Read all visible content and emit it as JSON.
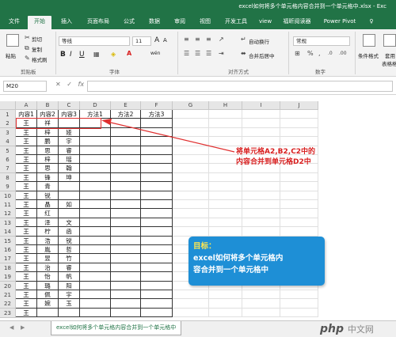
{
  "window": {
    "title": "excel如何将多个单元格内容合并到一个单元格中.xlsx - Exc"
  },
  "ribbon_tabs": [
    "文件",
    "开始",
    "插入",
    "页面布局",
    "公式",
    "数据",
    "审阅",
    "视图",
    "开发工具",
    "view",
    "福昕阅读器",
    "Power Pivot",
    "♀"
  ],
  "ribbon": {
    "clipboard": {
      "paste": "粘贴",
      "cut": "剪切",
      "copy": "复制",
      "format_painter": "格式刷",
      "label": "剪贴板"
    },
    "font": {
      "name": "等线",
      "size": "11",
      "bold": "B",
      "italic": "I",
      "underline": "U",
      "grow": "A",
      "shrink": "A",
      "wen": "wén",
      "label": "字体"
    },
    "alignment": {
      "wrap": "自动换行",
      "merge": "合并后居中",
      "label": "对齐方式"
    },
    "number": {
      "format": "常规",
      "label": "数字"
    },
    "styles": {
      "conditional": "条件格式",
      "table": "套用",
      "table2": "表格格"
    }
  },
  "formula_bar": {
    "name_box": "M20",
    "fx": "fx"
  },
  "columns": [
    "A",
    "B",
    "C",
    "D",
    "E",
    "F",
    "G",
    "H",
    "I",
    "J"
  ],
  "rows": [
    [
      "内容1",
      "内容2",
      "内容3",
      "方法1",
      "方法2",
      "方法3"
    ],
    [
      "王",
      "祥",
      "",
      "",
      "",
      ""
    ],
    [
      "王",
      "梓",
      "娅",
      "",
      "",
      ""
    ],
    [
      "王",
      "鹏",
      "宇",
      "",
      "",
      ""
    ],
    [
      "王",
      "思",
      "睿",
      "",
      "",
      ""
    ],
    [
      "王",
      "梓",
      "瑶",
      "",
      "",
      ""
    ],
    [
      "王",
      "思",
      "翰",
      "",
      "",
      ""
    ],
    [
      "王",
      "锋",
      "坤",
      "",
      "",
      ""
    ],
    [
      "王",
      "青",
      "",
      "",
      "",
      ""
    ],
    [
      "王",
      "锐",
      "",
      "",
      "",
      ""
    ],
    [
      "王",
      "晶",
      "如",
      "",
      "",
      ""
    ],
    [
      "王",
      "红",
      "",
      "",
      "",
      ""
    ],
    [
      "王",
      "泽",
      "文",
      "",
      "",
      ""
    ],
    [
      "王",
      "柠",
      "函",
      "",
      "",
      ""
    ],
    [
      "王",
      "浩",
      "锐",
      "",
      "",
      ""
    ],
    [
      "王",
      "胤",
      "哲",
      "",
      "",
      ""
    ],
    [
      "王",
      "昱",
      "竹",
      "",
      "",
      ""
    ],
    [
      "王",
      "治",
      "睿",
      "",
      "",
      ""
    ],
    [
      "王",
      "怡",
      "帆",
      "",
      "",
      ""
    ],
    [
      "王",
      "璐",
      "阳",
      "",
      "",
      ""
    ],
    [
      "王",
      "佩",
      "宇",
      "",
      "",
      ""
    ],
    [
      "王",
      "婉",
      "玉",
      "",
      "",
      ""
    ],
    [
      "王",
      "",
      "",
      "",
      "",
      ""
    ]
  ],
  "row_numbers": [
    "1",
    "2",
    "3",
    "4",
    "5",
    "6",
    "7",
    "8",
    "9",
    "10",
    "11",
    "12",
    "13",
    "14",
    "15",
    "16",
    "17",
    "18",
    "19",
    "20",
    "21",
    "22",
    "23"
  ],
  "annotation": {
    "line1": "将单元格A2,B2,C2中的",
    "line2": "内容合并到单元格D2中"
  },
  "goal": {
    "title": "目标：",
    "line1": "excel如何将多个单元格内",
    "line2": "容合并到一个单元格中"
  },
  "sheet_tab": "excel如何将多个单元格内容合并到一个单元格中",
  "watermark": {
    "brand": "php",
    "site": "中文网"
  },
  "colors": {
    "accent": "#217346",
    "red": "#d81e1e",
    "goal_bg": "#1e8fd6"
  }
}
